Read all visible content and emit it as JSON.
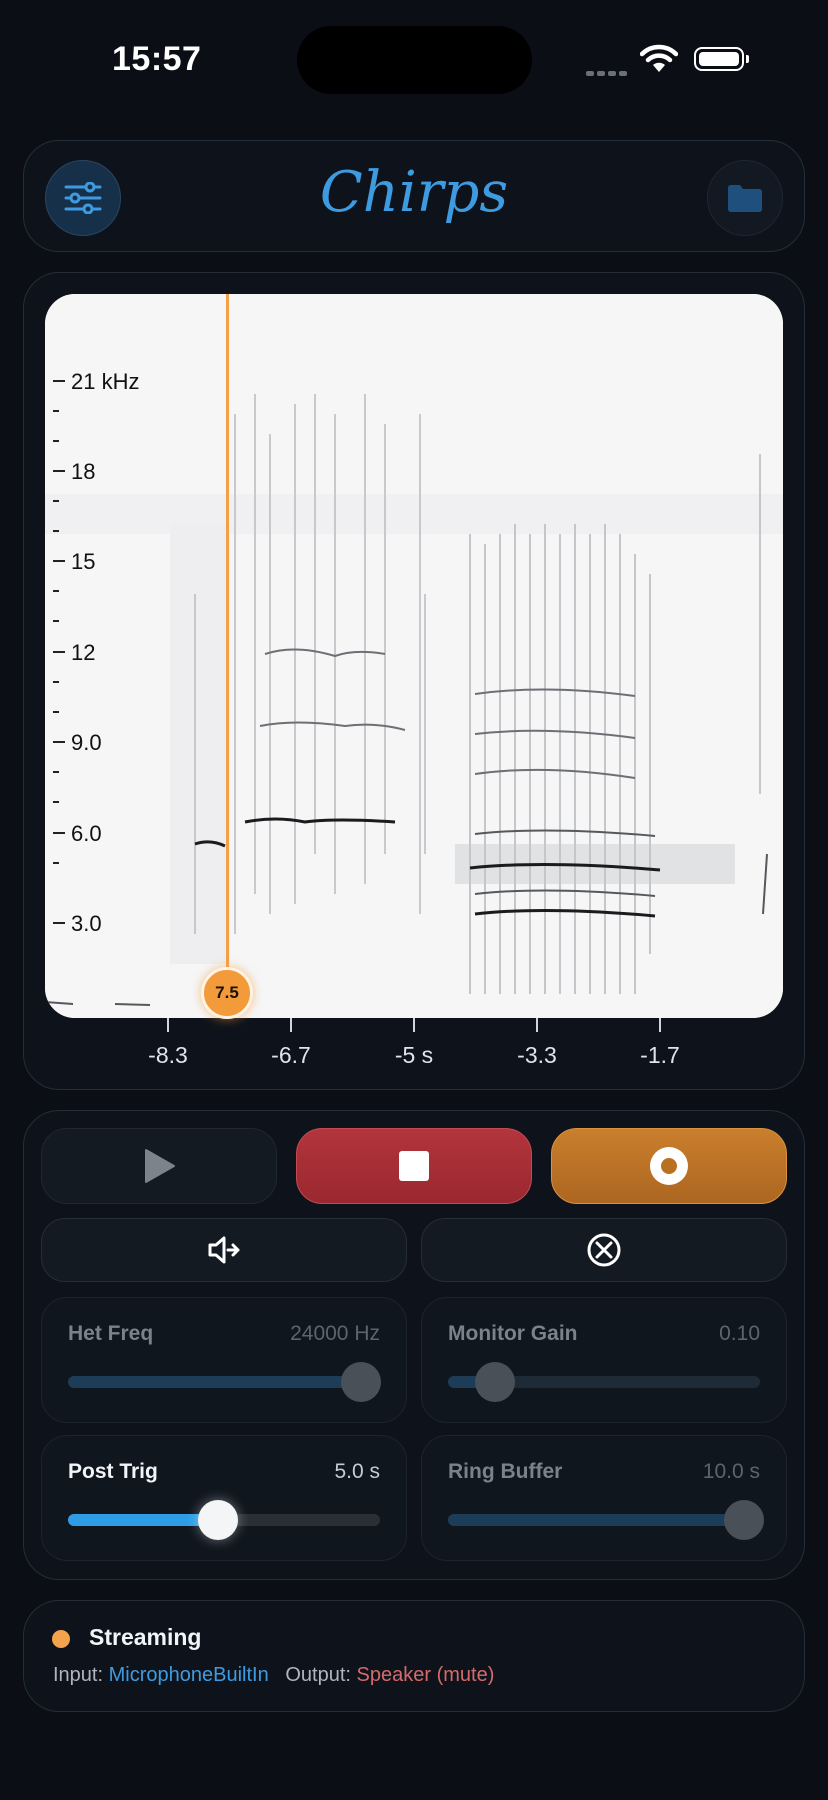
{
  "status_bar": {
    "time": "15:57"
  },
  "header": {
    "title": "Chirps",
    "settings_icon": "sliders-icon",
    "folder_icon": "folder-icon",
    "accent": "#3e9be0"
  },
  "spectrogram": {
    "freq_labels": [
      "21 kHz",
      "18",
      "15",
      "12",
      "9.0",
      "6.0",
      "3.0"
    ],
    "time_labels": [
      "-8.3",
      "-6.7",
      "-5 s",
      "-3.3",
      "-1.7"
    ],
    "cursor_value": "7.5",
    "cursor_color": "#f3a048"
  },
  "transport": {
    "play_icon": "play-icon",
    "stop_icon": "stop-icon",
    "record_icon": "record-icon",
    "monitor_icon": "speaker-arrow-icon",
    "clear_icon": "clear-x-circle-icon"
  },
  "params": {
    "het_freq": {
      "label": "Het Freq",
      "value": "24000 Hz",
      "level": 0.94
    },
    "monitor_gain": {
      "label": "Monitor Gain",
      "value": "0.10",
      "level": 0.15
    },
    "post_trig": {
      "label": "Post Trig",
      "value": "5.0 s",
      "level": 0.48
    },
    "ring_buffer": {
      "label": "Ring Buffer",
      "value": "10.0 s",
      "level": 0.95
    }
  },
  "status": {
    "state": "Streaming",
    "input_label": "Input:",
    "input_value": "MicrophoneBuiltIn",
    "output_label": "Output:",
    "output_value": "Speaker (mute)"
  }
}
